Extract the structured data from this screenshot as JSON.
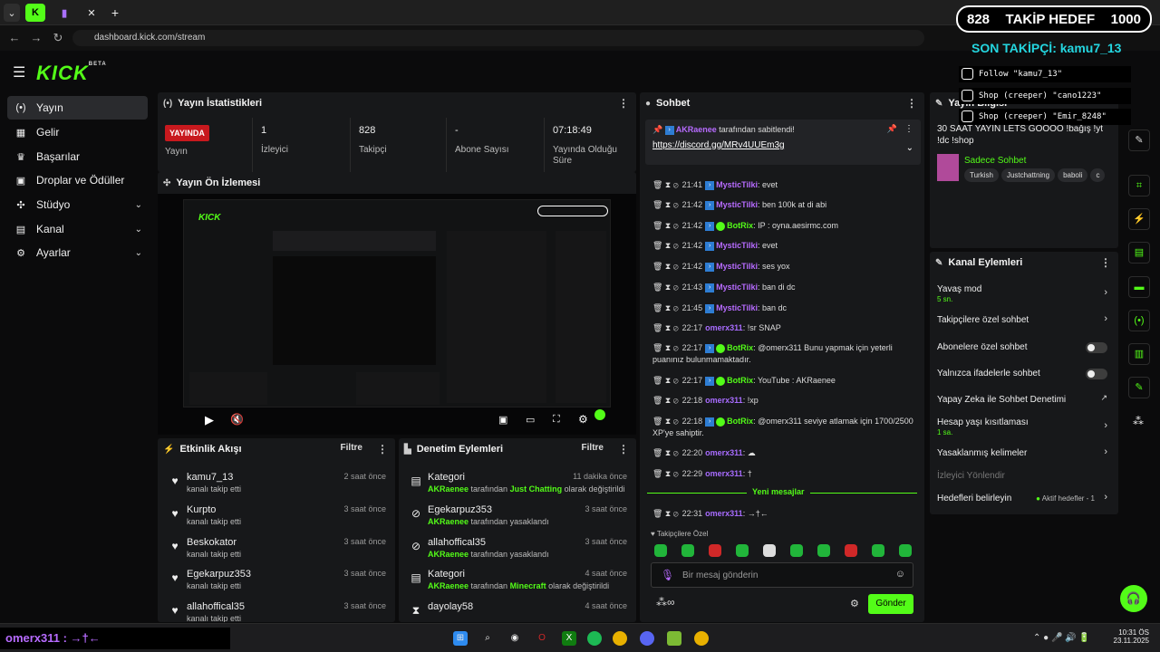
{
  "browser": {
    "url": "dashboard.kick.com/stream",
    "tab_icons": [
      "kick-tab-icon",
      "twitch-tab-icon",
      "tab-icon"
    ],
    "new_tab": "+"
  },
  "brand": {
    "logo": "KICK",
    "beta": "BETA",
    "accent": "#53fc18"
  },
  "sidebar": {
    "items": [
      {
        "label": "Yayın",
        "icon": "broadcast-icon"
      },
      {
        "label": "Gelir",
        "icon": "revenue-icon"
      },
      {
        "label": "Başarılar",
        "icon": "trophy-icon"
      },
      {
        "label": "Droplar ve Ödüller",
        "icon": "gift-icon"
      },
      {
        "label": "Stüdyo",
        "icon": "studio-icon"
      },
      {
        "label": "Kanal",
        "icon": "channel-icon"
      },
      {
        "label": "Ayarlar",
        "icon": "settings-icon"
      }
    ]
  },
  "stats": {
    "title": "Yayın İstatistikleri",
    "live_badge": "YAYINDA",
    "live_label": "Yayın",
    "viewers_value": "1",
    "viewers_label": "İzleyici",
    "followers_value": "828",
    "followers_label": "Takipçi",
    "subs_value": "-",
    "subs_label": "Abone Sayısı",
    "uptime_value": "07:18:49",
    "uptime_label": "Yayında Olduğu Süre"
  },
  "preview": {
    "title": "Yayın Ön İzlemesi"
  },
  "activity": {
    "title": "Etkinlik Akışı",
    "filter": "Filtre",
    "rows": [
      {
        "name": "kamu7_13",
        "sub": "kanalı takip etti",
        "time": "2 saat önce"
      },
      {
        "name": "Kurpto",
        "sub": "kanalı takip etti",
        "time": "3 saat önce"
      },
      {
        "name": "Beskokator",
        "sub": "kanalı takip etti",
        "time": "3 saat önce"
      },
      {
        "name": "Egekarpuz353",
        "sub": "kanalı takip etti",
        "time": "3 saat önce"
      },
      {
        "name": "allahoffical35",
        "sub": "kanalı takip etti",
        "time": "3 saat önce"
      }
    ]
  },
  "moderation": {
    "title": "Denetim Eylemleri",
    "filter": "Filtre",
    "rows": [
      {
        "name": "Kategori",
        "actor": "AKRaenee",
        "mid": " tarafından ",
        "target": "Just Chatting",
        "end": " olarak değiştirildi",
        "time": "11 dakika önce"
      },
      {
        "name": "Egekarpuz353",
        "actor": "AKRaenee",
        "mid": " tarafından yasaklandı",
        "target": "",
        "end": "",
        "time": "3 saat önce"
      },
      {
        "name": "allahoffical35",
        "actor": "AKRaenee",
        "mid": " tarafından yasaklandı",
        "target": "",
        "end": "",
        "time": "3 saat önce"
      },
      {
        "name": "Kategori",
        "actor": "AKRaenee",
        "mid": " tarafından ",
        "target": "Minecraft",
        "end": " olarak değiştirildi",
        "time": "4 saat önce"
      },
      {
        "name": "dayolay58",
        "actor": "",
        "mid": "",
        "target": "",
        "end": "",
        "time": "4 saat önce"
      }
    ]
  },
  "chat": {
    "title": "Sohbet",
    "pinned_by": "AKRaenee",
    "pinned_suffix": " tarafından sabitlendi!",
    "pinned_link": "https://discord.gg/MRv4UUEm3g",
    "messages": [
      {
        "time": "21:41",
        "user": "MysticTilki",
        "text": ": evet"
      },
      {
        "time": "21:42",
        "user": "MysticTilki",
        "text": ": ben 100k at di abi"
      },
      {
        "time": "21:42",
        "user": "BotRix",
        "text": ": IP : oyna.aesirmc.com"
      },
      {
        "time": "21:42",
        "user": "MysticTilki",
        "text": ": evet"
      },
      {
        "time": "21:42",
        "user": "MysticTilki",
        "text": ": ses yox"
      },
      {
        "time": "21:43",
        "user": "MysticTilki",
        "text": ": ban di dc"
      },
      {
        "time": "21:45",
        "user": "MysticTilki",
        "text": ": ban dc"
      },
      {
        "time": "22:17",
        "user": "omerx311",
        "text": ": !sr SNAP"
      },
      {
        "time": "22:17",
        "user": "BotRix",
        "text": ": @omerx311 Bunu yapmak için yeterli puanınız bulunmamaktadır."
      },
      {
        "time": "22:17",
        "user": "BotRix",
        "text": ": YouTube : AKRaenee"
      },
      {
        "time": "22:18",
        "user": "omerx311",
        "text": ": !xp"
      },
      {
        "time": "22:18",
        "user": "BotRix",
        "text": ": @omerx311 seviye atlamak için 1700/2500 XP'ye sahiptir."
      },
      {
        "time": "22:20",
        "user": "omerx311",
        "text": ": ☁"
      },
      {
        "time": "22:29",
        "user": "omerx311",
        "text": ": †"
      },
      {
        "time": "22:31",
        "user": "omerx311",
        "text": ": →†←"
      }
    ],
    "new_messages": "Yeni mesajlar",
    "followers_only": "Takipçilere Özel",
    "placeholder": "Bir mesaj gönderin",
    "send": "Gönder"
  },
  "stream_info": {
    "title": "Yayın Bilgisi",
    "stream_title": "30 SAAT YAYIN LETS GOOOO !bağış !yt !dc !shop",
    "category": "Sadece Sohbet",
    "tags": [
      "Turkish",
      "Justchattning",
      "baboli",
      "c"
    ]
  },
  "channel_actions": {
    "title": "Kanal Eylemleri",
    "slow_mode": "Yavaş mod",
    "slow_value": "5 sn.",
    "followers_chat": "Takipçilere özel sohbet",
    "subs_chat": "Abonelere özel sohbet",
    "emote_chat": "Yalnızca ifadelerle sohbet",
    "ai_mod": "Yapay Zeka ile Sohbet Denetimi",
    "account_age": "Hesap yaşı kısıtlaması",
    "account_age_value": "1 sa.",
    "banned_words": "Yasaklanmış kelimeler",
    "redirect": "İzleyici Yönlendir",
    "goals": "Hedefleri belirleyin",
    "goals_status": "Aktif hedefler - 1"
  },
  "overlay": {
    "goal_current": "828",
    "goal_label": "TAKİP HEDEF",
    "goal_target": "1000",
    "last_follower": "SON TAKİPÇİ: kamu7_13",
    "events": [
      "Follow \"kamu7_13\"",
      "Shop (creeper) \"cano1223\"",
      "Shop (creeper) \"Emir_8248\""
    ]
  },
  "bottom_chat": "omerx311 : →†←",
  "taskbar": {
    "time": "10:31 ÖS",
    "date": "23.11.2025"
  }
}
